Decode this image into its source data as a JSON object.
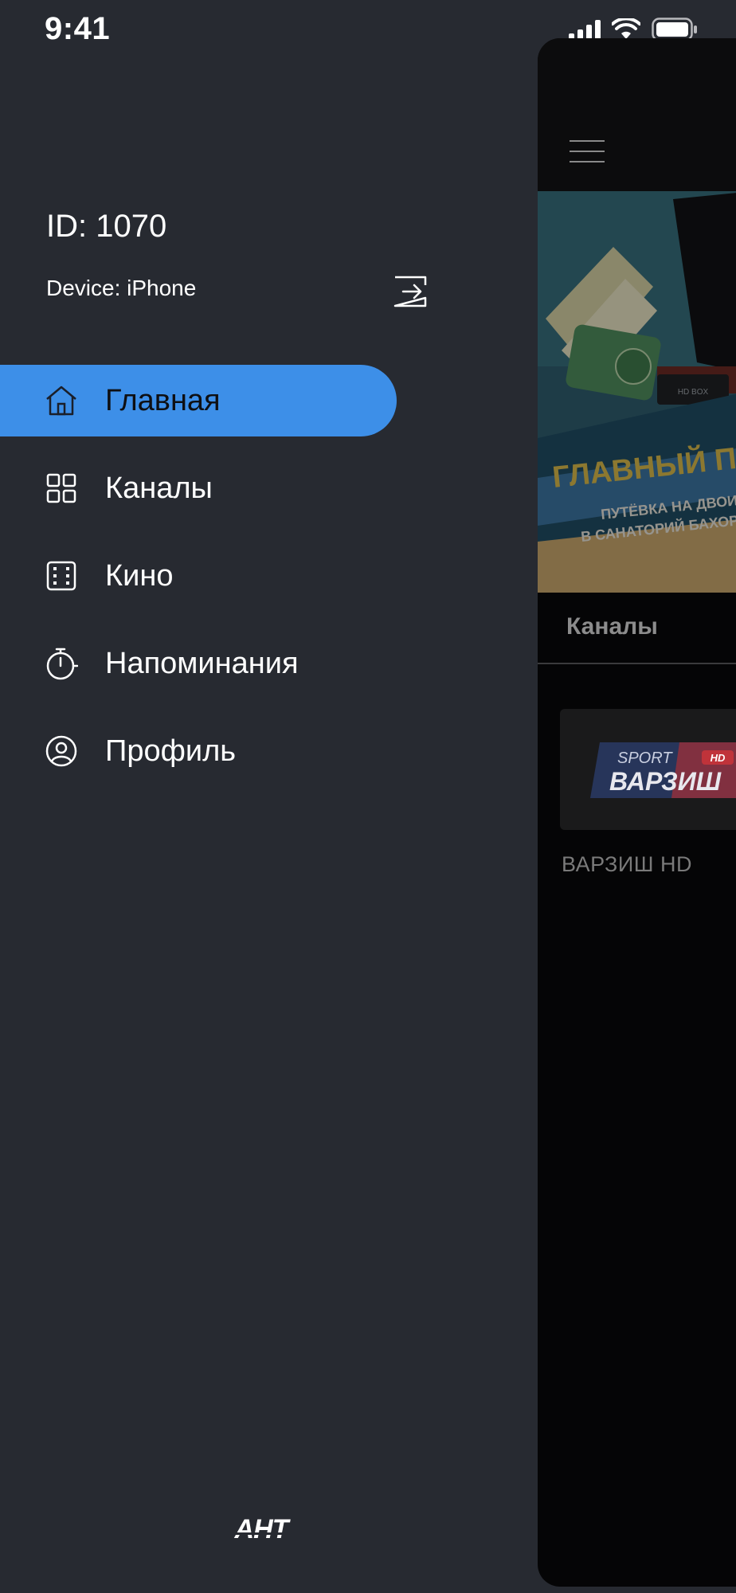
{
  "status_bar": {
    "time": "9:41",
    "icons": [
      "signal-icon",
      "wifi-icon",
      "battery-icon"
    ]
  },
  "side_menu": {
    "user_id": "ID: 1070",
    "device": "Device: iPhone",
    "logout_icon": "logout-icon",
    "items": [
      {
        "label": "Главная",
        "icon": "home-icon",
        "active": true
      },
      {
        "label": "Каналы",
        "icon": "grid-icon",
        "active": false
      },
      {
        "label": "Кино",
        "icon": "film-icon",
        "active": false
      },
      {
        "label": "Напоминания",
        "icon": "stopwatch-icon",
        "active": false
      },
      {
        "label": "Профиль",
        "icon": "user-circle-icon",
        "active": false
      }
    ],
    "brand": "АНТ",
    "accent_color": "#3d8fe8",
    "background_color": "#272a31"
  },
  "background_screen": {
    "banner": {
      "headline": "ГЛАВНЫЙ ПРИЗ",
      "line1": "ПУТЁВКА НА ДВОИХ",
      "line2": "В САНАТОРИЙ БАХОРИСТОН",
      "box_label": "HD BOX"
    },
    "section_title": "Каналы",
    "channels": [
      {
        "name": "ВАРЗИШ HD",
        "logo_top": "SPORT",
        "logo_main": "ВАРЗИШ",
        "logo_badge": "HD"
      }
    ]
  }
}
